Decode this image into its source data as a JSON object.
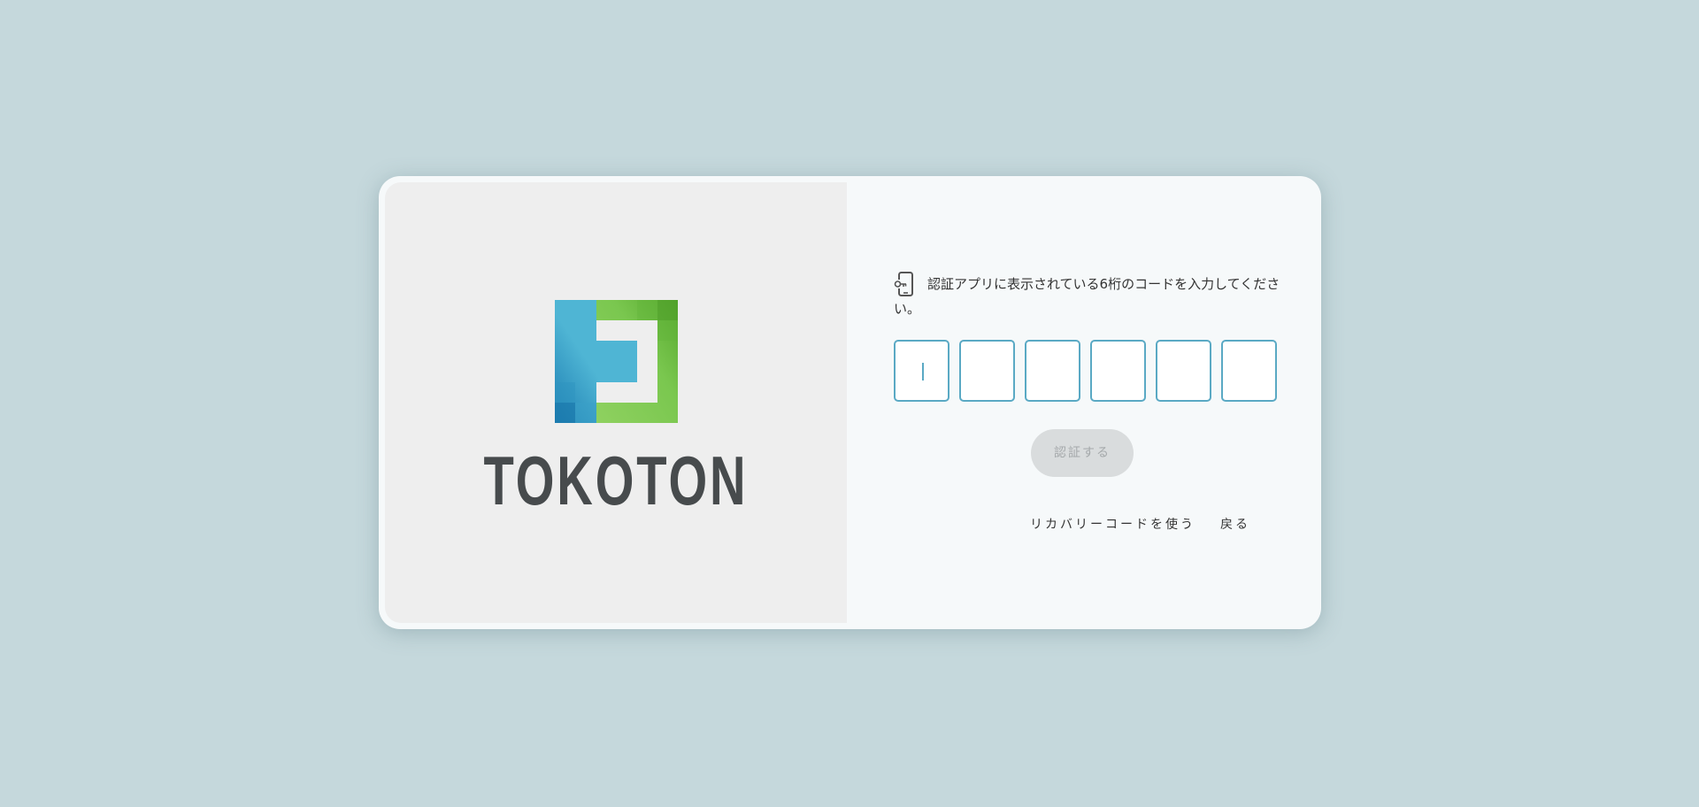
{
  "brand": {
    "name": "TOKOTON",
    "colors": {
      "blue": "#4fb5d4",
      "dark_blue": "#1d7fb3",
      "green": "#7ac74f",
      "dark_green": "#57a92e",
      "text": "#474b4d"
    }
  },
  "auth": {
    "icon": "phone-key-icon",
    "prompt": "認証アプリに表示されている6桁のコードを入力してください。",
    "code_digits": [
      "",
      "",
      "",
      "",
      "",
      ""
    ],
    "submit_label": "認証する",
    "recovery_link": "リカバリーコードを使う",
    "back_link": "戻る"
  }
}
